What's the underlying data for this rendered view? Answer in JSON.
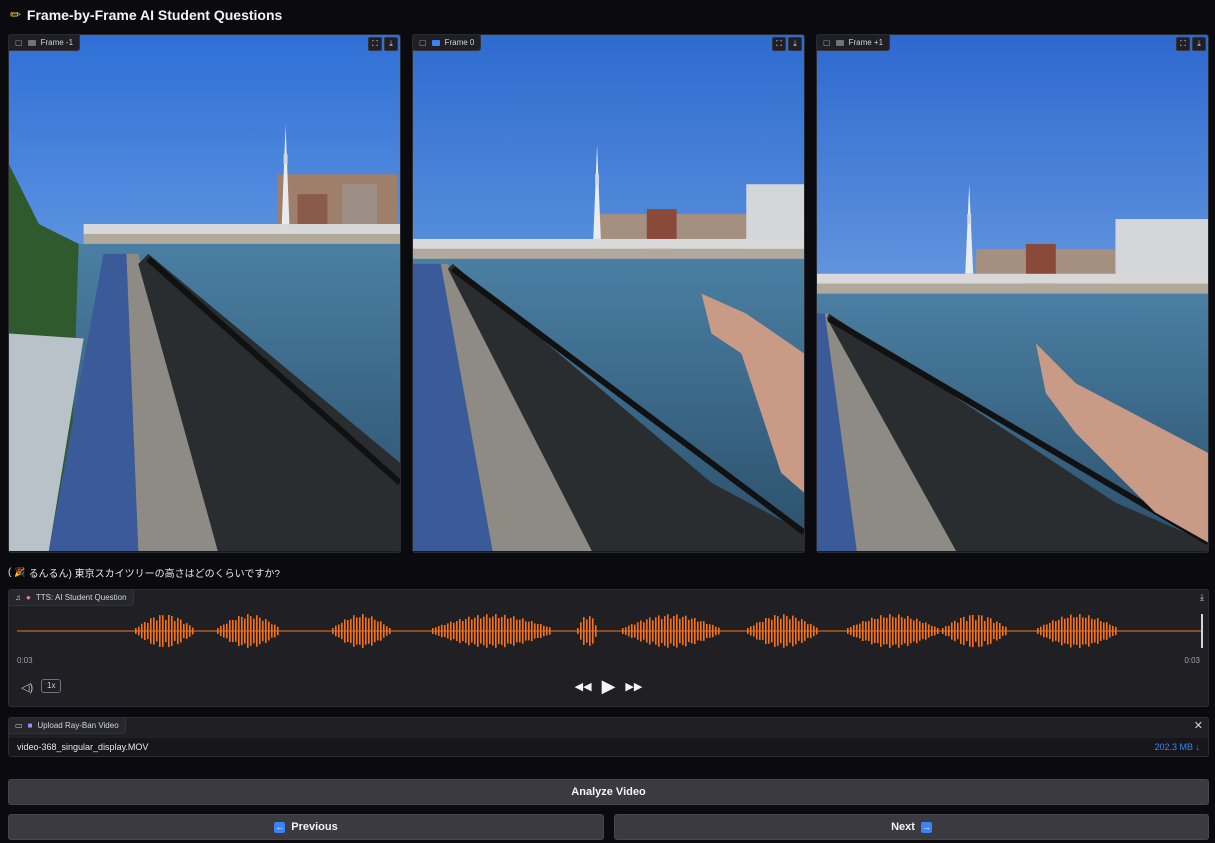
{
  "app": {
    "title": "Frame-by-Frame AI Student Questions",
    "title_icon": "pencil-icon"
  },
  "frames": [
    {
      "label": "Frame -1"
    },
    {
      "label": "Frame 0"
    },
    {
      "label": "Frame +1"
    }
  ],
  "question": {
    "speaker_icon": "party-popper-icon",
    "prefix": "(",
    "text": "るんるん) 東京スカイツリーの高さはどのくらいですか?"
  },
  "audio": {
    "label": "TTS: AI Student Question",
    "time_current": "0:03",
    "time_total": "0:03",
    "speed": "1x",
    "wave_color": "#f97316"
  },
  "upload": {
    "label": "Upload Ray-Ban Video",
    "file_name": "video-368_singular_display.MOV",
    "file_size": "202.3 MB ↓"
  },
  "buttons": {
    "analyze": "Analyze Video",
    "previous": "Previous",
    "next": "Next"
  }
}
